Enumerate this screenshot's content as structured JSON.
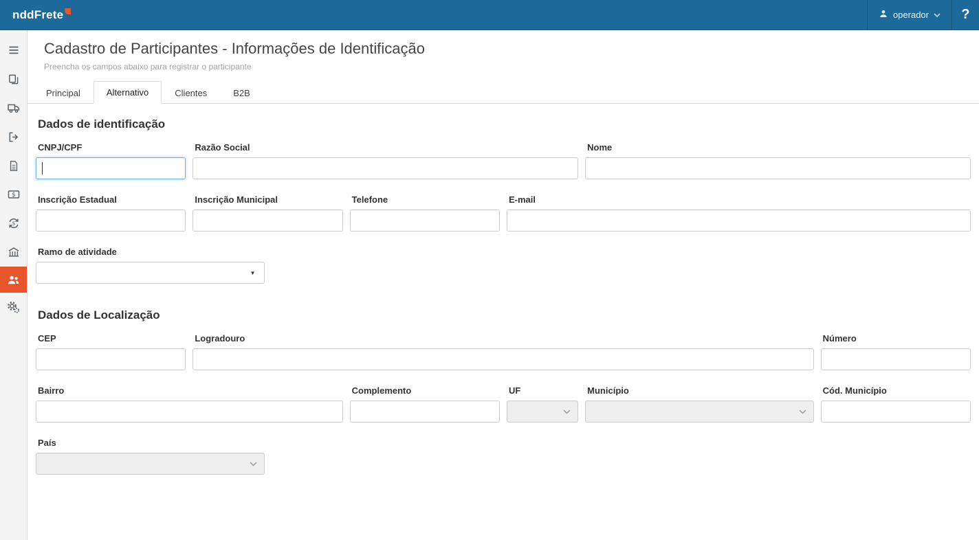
{
  "colors": {
    "header_blue": "#1b6a99",
    "accent_orange": "#e8542c"
  },
  "header": {
    "logo": "nddFrete",
    "user": "operador",
    "help": "?"
  },
  "sidebar": {
    "items": [
      "menu",
      "copy-pages",
      "truck",
      "sign-out",
      "document",
      "payment-check",
      "currency-exchange",
      "company-building",
      "participants-group",
      "settings-gears"
    ],
    "active_item": "participants-group"
  },
  "page": {
    "title": "Cadastro de Participantes - Informações de Identificação",
    "subtitle": "Preencha os campos abaixo para registrar o participante"
  },
  "tabs": [
    {
      "label": "Principal",
      "active": false
    },
    {
      "label": "Alternativo",
      "active": true
    },
    {
      "label": "Clientes",
      "active": false
    },
    {
      "label": "B2B",
      "active": false
    }
  ],
  "identification": {
    "heading": "Dados de identificação",
    "cnpj": {
      "label": "CNPJ/CPF",
      "value": ""
    },
    "razao_social": {
      "label": "Razão Social",
      "value": ""
    },
    "nome": {
      "label": "Nome",
      "value": ""
    },
    "inscricao_estadual": {
      "label": "Inscrição Estadual",
      "value": ""
    },
    "inscricao_municipal": {
      "label": "Inscrição Municipal",
      "value": ""
    },
    "telefone": {
      "label": "Telefone",
      "value": ""
    },
    "email": {
      "label": "E-mail",
      "value": ""
    },
    "ramo_atividade": {
      "label": "Ramo de atividade",
      "value": ""
    }
  },
  "location": {
    "heading": "Dados de Localização",
    "cep": {
      "label": "CEP",
      "value": ""
    },
    "logradouro": {
      "label": "Logradouro",
      "value": ""
    },
    "numero": {
      "label": "Número",
      "value": ""
    },
    "bairro": {
      "label": "Bairro",
      "value": ""
    },
    "complemento": {
      "label": "Complemento",
      "value": ""
    },
    "uf": {
      "label": "UF",
      "value": ""
    },
    "municipio": {
      "label": "Município",
      "value": ""
    },
    "cod_municipio": {
      "label": "Cód. Município",
      "value": ""
    },
    "pais": {
      "label": "País",
      "value": ""
    }
  }
}
